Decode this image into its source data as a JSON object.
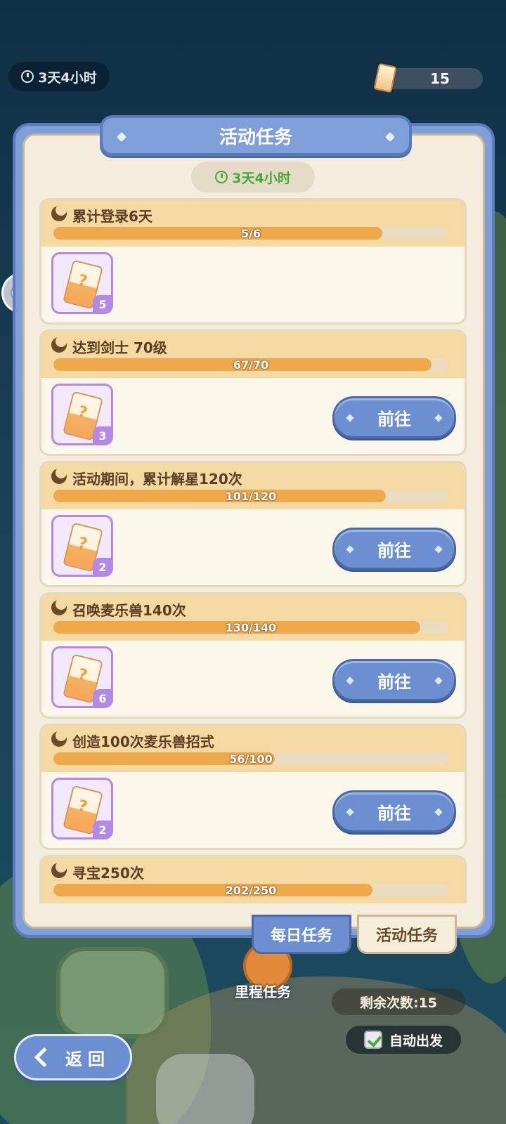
{
  "top_bar": {
    "timer": "3天4小时",
    "currency_amount": "15"
  },
  "panel": {
    "title": "活动任务",
    "timer": "3天4小时"
  },
  "tasks": [
    {
      "title": "累计登录6天",
      "progress_text": "5/6",
      "progress": 0.833,
      "reward_count": "5",
      "has_button": false
    },
    {
      "title": "达到剑士 70级",
      "progress_text": "67/70",
      "progress": 0.957,
      "reward_count": "3",
      "has_button": true
    },
    {
      "title": "活动期间，累计解星120次",
      "progress_text": "101/120",
      "progress": 0.842,
      "reward_count": "2",
      "has_button": true
    },
    {
      "title": "召唤麦乐兽140次",
      "progress_text": "130/140",
      "progress": 0.929,
      "reward_count": "6",
      "has_button": true
    },
    {
      "title": "创造100次麦乐兽招式",
      "progress_text": "56/100",
      "progress": 0.56,
      "reward_count": "2",
      "has_button": true
    },
    {
      "title": "寻宝250次",
      "progress_text": "202/250",
      "progress": 0.808,
      "reward_count": "",
      "has_button": false
    }
  ],
  "go_label": "前往",
  "tabs": {
    "daily": "每日任务",
    "event": "活动任务",
    "active": "event"
  },
  "bottom": {
    "milestone": "里程任务",
    "remaining": "剩余次数:15",
    "auto_go": "自动出发",
    "auto_go_checked": true,
    "back": "返回"
  },
  "colors": {
    "accent_blue": "#6b8fd1",
    "progress_fill": "#efa84a",
    "timer_green": "#4aa83b",
    "reward_purple": "#b289e6"
  },
  "icons": [
    "clock-icon",
    "ticket-icon",
    "chat-icon",
    "task-badge-icon",
    "mystery-card-icon",
    "checkbox-icon",
    "back-arrow-icon"
  ]
}
